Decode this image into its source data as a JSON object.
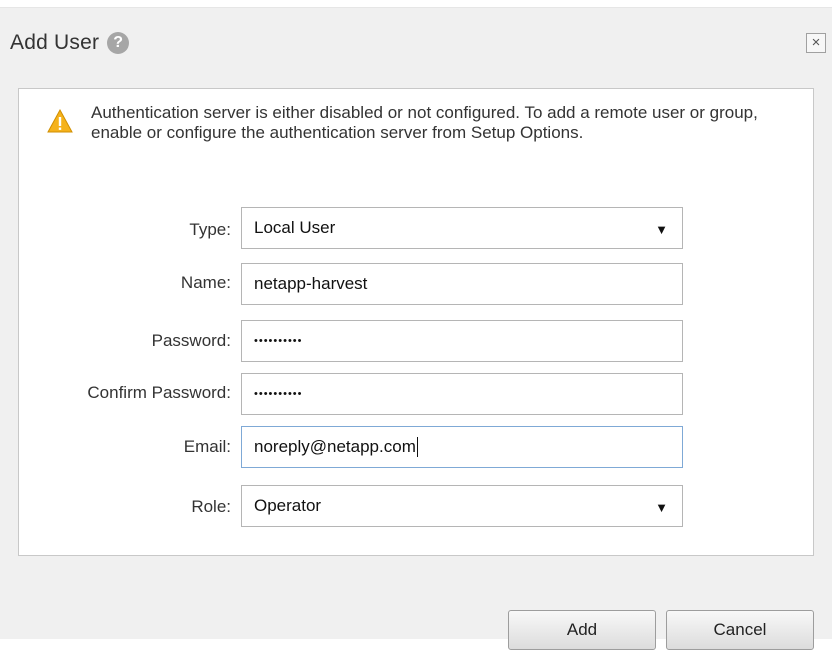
{
  "dialog": {
    "title": "Add User",
    "help_icon": "help-icon",
    "close_icon": "close-icon",
    "close_symbol": "×"
  },
  "warning": {
    "icon": "warning-icon",
    "text": "Authentication server is either disabled or not configured. To add a remote user or group, enable or configure the authentication server from Setup Options."
  },
  "form": {
    "type": {
      "label": "Type:",
      "value": "Local User"
    },
    "name": {
      "label": "Name:",
      "value": "netapp-harvest"
    },
    "password": {
      "label": "Password:",
      "value": "••••••••••"
    },
    "confirm_password": {
      "label": "Confirm Password:",
      "value": "••••••••••"
    },
    "email": {
      "label": "Email:",
      "value": "noreply@netapp.com"
    },
    "role": {
      "label": "Role:",
      "value": "Operator"
    },
    "select_arrow": "▼"
  },
  "buttons": {
    "add": "Add",
    "cancel": "Cancel"
  },
  "colors": {
    "warning": "#f5b21b",
    "dialog_bg": "#f0f0f0",
    "focus_border": "#7fa9d6"
  }
}
